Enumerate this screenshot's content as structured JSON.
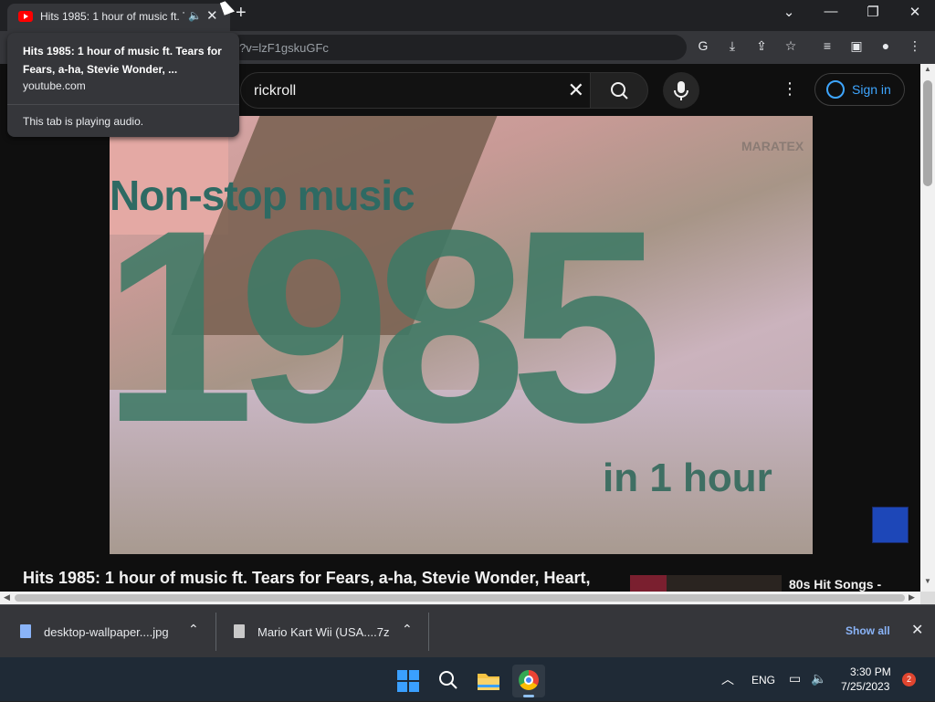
{
  "browser": {
    "tab_title": "Hits 1985: 1 hour of music ft. Tears for Fears, a-ha, Stevie Wonder, Heart,",
    "new_tab": "+",
    "url": "?v=lzF1gskuGFc",
    "window_controls": [
      "minimize",
      "restore",
      "close"
    ]
  },
  "tab_hover": {
    "title": "Hits 1985: 1 hour of music ft. Tears for Fears, a-ha, Stevie Wonder, ...",
    "domain": "youtube.com",
    "audio_status": "This tab is playing audio."
  },
  "youtube": {
    "search_query": "rickroll",
    "sign_in_label": "Sign in",
    "video_overlay": {
      "headline": "Non-stop music",
      "year": "1985",
      "subline": "in 1 hour",
      "watermark": "MARATEX"
    },
    "video_title": "Hits 1985: 1 hour of music ft. Tears for Fears, a-ha, Stevie Wonder, Heart,",
    "suggestion_title": "80s Hit Songs -"
  },
  "downloads": {
    "items": [
      {
        "name": "desktop-wallpaper....jpg"
      },
      {
        "name": "Mario Kart Wii (USA....7z"
      }
    ],
    "show_all_label": "Show all"
  },
  "taskbar": {
    "language": "ENG",
    "time": "3:30 PM",
    "date": "7/25/2023",
    "notifications": "2"
  },
  "colors": {
    "accent_link": "#3ea6ff",
    "youtube_red": "#ff0000",
    "taskbar_bg": "#1f2a36"
  }
}
